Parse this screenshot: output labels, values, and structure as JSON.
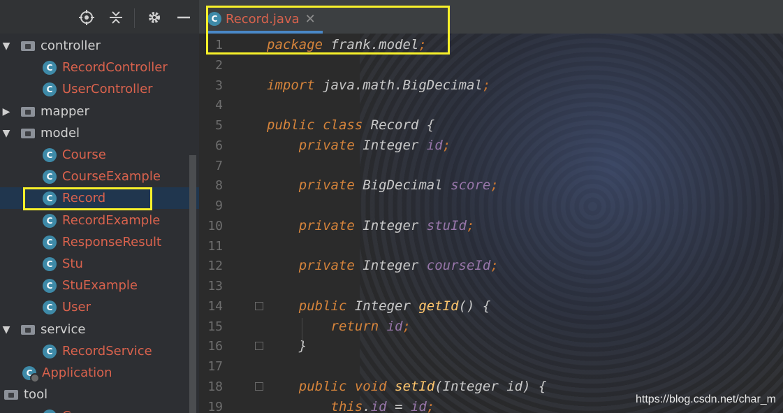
{
  "sidebar": {
    "toolbar_icons": [
      "locate-icon",
      "collapse-icon",
      "gear-icon",
      "minimize-icon"
    ],
    "tree": [
      {
        "label": "controller",
        "kind": "package",
        "arrow": "▼"
      },
      {
        "label": "RecordController",
        "kind": "class"
      },
      {
        "label": "UserController",
        "kind": "class"
      },
      {
        "label": "mapper",
        "kind": "package",
        "arrow": "▶"
      },
      {
        "label": "model",
        "kind": "package",
        "arrow": "▼"
      },
      {
        "label": "Course",
        "kind": "class"
      },
      {
        "label": "CourseExample",
        "kind": "class"
      },
      {
        "label": "Record",
        "kind": "class",
        "selected": true
      },
      {
        "label": "RecordExample",
        "kind": "class"
      },
      {
        "label": "ResponseResult",
        "kind": "class"
      },
      {
        "label": "Stu",
        "kind": "class"
      },
      {
        "label": "StuExample",
        "kind": "class"
      },
      {
        "label": "User",
        "kind": "class"
      },
      {
        "label": "service",
        "kind": "package",
        "arrow": "▼"
      },
      {
        "label": "RecordService",
        "kind": "class"
      },
      {
        "label": "Application",
        "kind": "app"
      },
      {
        "label": "tool",
        "kind": "package"
      },
      {
        "label": "C...",
        "kind": "class"
      }
    ],
    "class_icon_letter": "C"
  },
  "editor": {
    "tab_label": "Record.java",
    "tab_close": "✕",
    "line_numbers": [
      "1",
      "2",
      "3",
      "4",
      "5",
      "6",
      "7",
      "8",
      "9",
      "10",
      "11",
      "12",
      "13",
      "14",
      "15",
      "16",
      "17",
      "18",
      "19"
    ],
    "code": [
      "package frank.model;",
      "",
      "import java.math.BigDecimal;",
      "",
      "public class Record {",
      "    private Integer id;",
      "",
      "    private BigDecimal score;",
      "",
      "    private Integer stuId;",
      "",
      "    private Integer courseId;",
      "",
      "    public Integer getId() {",
      "        return id;",
      "    }",
      "",
      "    public void setId(Integer id) {",
      "        this.id = id;"
    ]
  },
  "watermark": "https://blog.csdn.net/char_m",
  "colors": {
    "highlight_box": "#f7f02a",
    "class_name": "#d9624d",
    "keyword": "#d6843b",
    "field": "#9876aa",
    "method": "#ffc66d"
  }
}
